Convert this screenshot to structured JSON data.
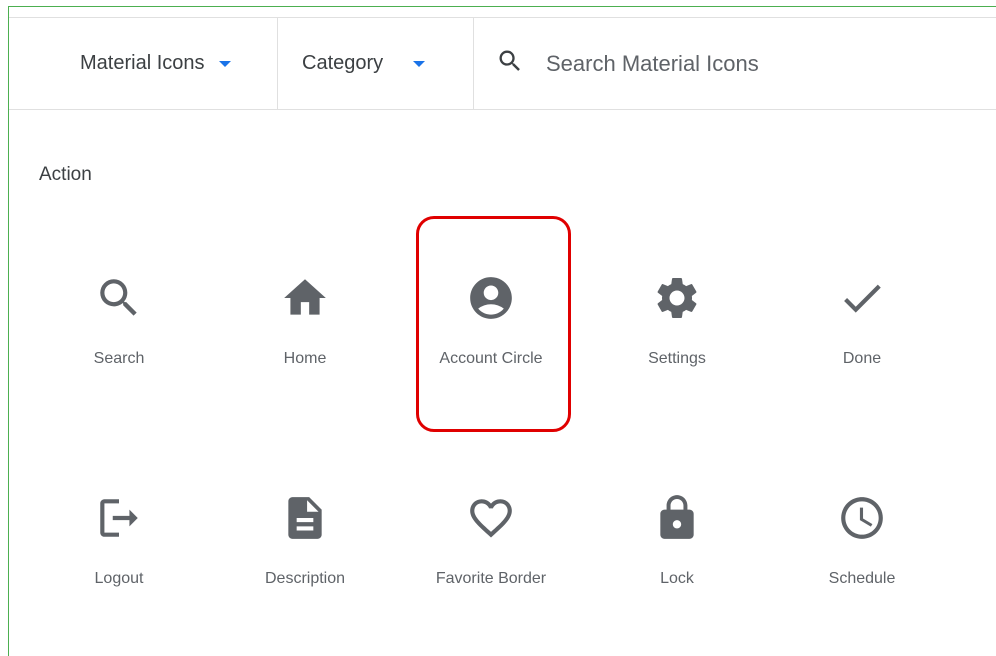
{
  "toolbar": {
    "icon_set_label": "Material Icons",
    "category_label": "Category",
    "search_placeholder": "Search Material Icons",
    "accent_color": "#1a73e8"
  },
  "section": {
    "title": "Action"
  },
  "icons": [
    {
      "label": "Search",
      "icon": "search-icon"
    },
    {
      "label": "Home",
      "icon": "home-icon"
    },
    {
      "label": "Account Circle",
      "icon": "account-circle-icon",
      "highlighted": true
    },
    {
      "label": "Settings",
      "icon": "settings-icon"
    },
    {
      "label": "Done",
      "icon": "done-icon"
    },
    {
      "label": "Logout",
      "icon": "logout-icon"
    },
    {
      "label": "Description",
      "icon": "description-icon"
    },
    {
      "label": "Favorite Border",
      "icon": "favorite-border-icon"
    },
    {
      "label": "Lock",
      "icon": "lock-icon"
    },
    {
      "label": "Schedule",
      "icon": "schedule-icon"
    }
  ],
  "highlight_color": "#e00000",
  "icon_color": "#5f6368"
}
